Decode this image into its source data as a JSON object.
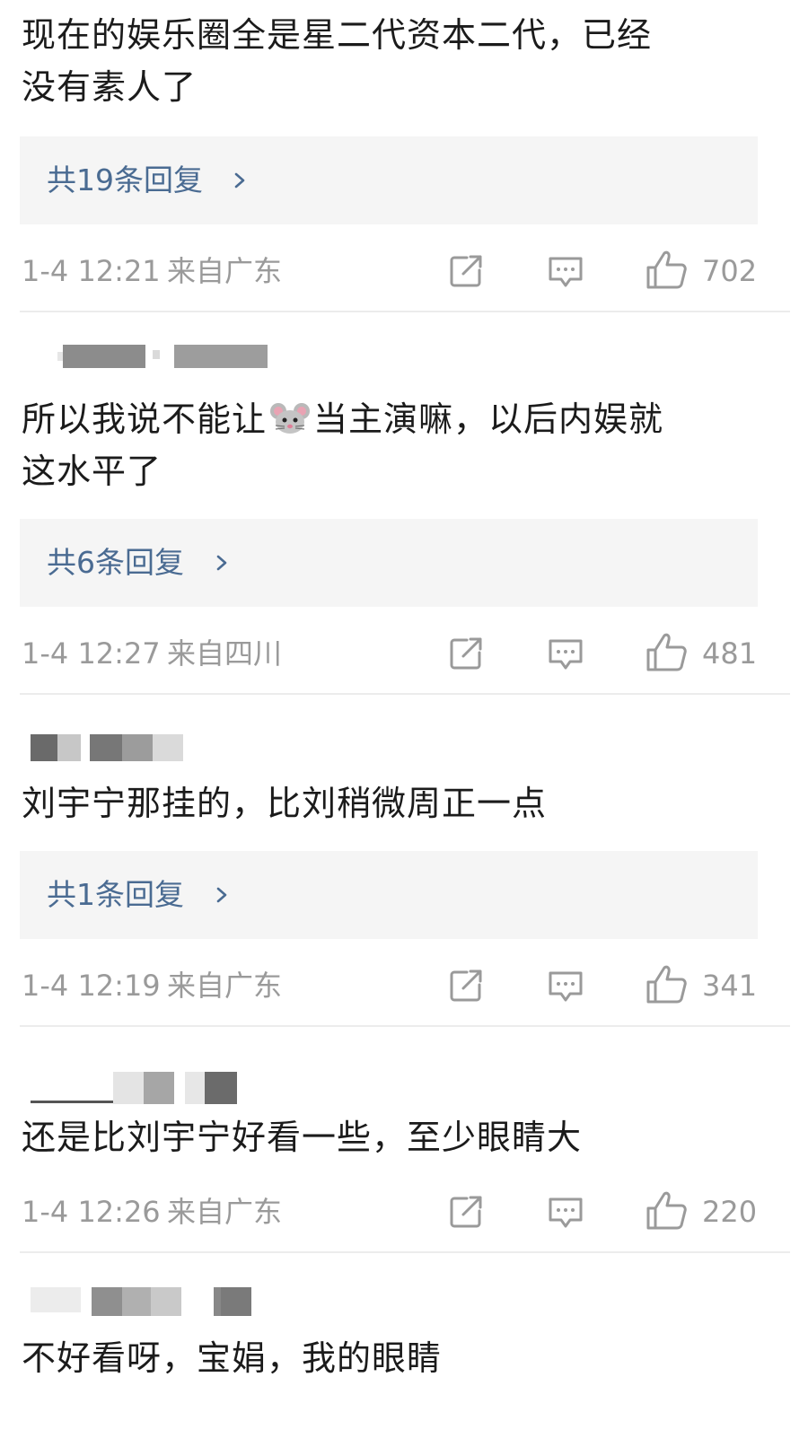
{
  "comments": [
    {
      "text": "现在的娱乐圈全是星二代资本二代，已经\n没有素人了",
      "reply_label": "共19条回复",
      "time": "1-4 12:21",
      "location": "来自广东",
      "likes": "702"
    },
    {
      "text_before": "所以我说不能让",
      "emoji": "mouse-emoji",
      "text_after": "当主演嘛，以后内娱就\n这水平了",
      "reply_label": "共6条回复",
      "time": "1-4 12:27",
      "location": "来自四川",
      "likes": "481"
    },
    {
      "text": "刘宇宁那挂的，比刘稍微周正一点",
      "reply_label": "共1条回复",
      "time": "1-4 12:19",
      "location": "来自广东",
      "likes": "341"
    },
    {
      "text": "还是比刘宇宁好看一些，至少眼睛大",
      "time": "1-4 12:26",
      "location": "来自广东",
      "likes": "220"
    },
    {
      "text": "不好看呀，宝娟，我的眼睛"
    }
  ],
  "icons": {
    "share": "share-icon",
    "comment": "comment-icon",
    "like": "thumbs-up-icon",
    "chevron": "chevron-right-icon"
  },
  "colors": {
    "reply_link": "#4a6b92",
    "meta_gray": "#9a9a9a",
    "reply_bg": "#f5f5f5"
  }
}
